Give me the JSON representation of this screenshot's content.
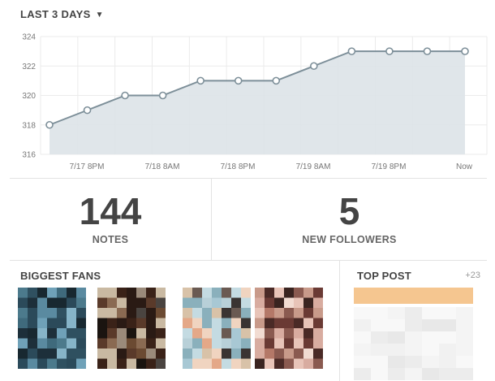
{
  "header": {
    "period_label": "LAST 3 DAYS"
  },
  "chart_data": {
    "type": "area",
    "x": [
      "7/17 8PM",
      "7/18 8AM",
      "7/18 8PM",
      "7/19 8AM",
      "7/19 8PM",
      "Now"
    ],
    "series": [
      {
        "values": [
          318,
          319,
          320,
          320,
          321,
          321,
          321,
          322,
          323,
          323,
          323,
          323
        ]
      }
    ],
    "ylim": [
      316,
      324
    ],
    "yticks": [
      316,
      318,
      320,
      322,
      324
    ],
    "xlabel": "",
    "ylabel": "",
    "title": "",
    "grid": true,
    "colors": {
      "line": "#7d8f99",
      "fill": "#dde3e8",
      "marker_fill": "#ffffff",
      "grid": "#ebebeb"
    }
  },
  "stats": {
    "notes": {
      "value": "144",
      "label": "NOTES"
    },
    "followers": {
      "value": "5",
      "label": "NEW FOLLOWERS"
    }
  },
  "fans": {
    "title": "BIGGEST FANS",
    "avatars": [
      {
        "palette": [
          "#2b4a5a",
          "#3f6a7c",
          "#5a8aa0",
          "#1d2f3a",
          "#6fa1b8",
          "#2f5060",
          "#4c7a8c",
          "#182830",
          "#86b4c8"
        ]
      },
      {
        "palette": [
          "#3a2218",
          "#6b4a32",
          "#8a6a52",
          "#2a1a14",
          "#4a4440",
          "#c9b9a2",
          "#5a3a2a",
          "#1a1410",
          "#9a8a7a"
        ]
      },
      {
        "palette": [
          "#a8c8d4",
          "#c4dbe2",
          "#8ab0bc",
          "#3a3432",
          "#d8c2a8",
          "#e4a888",
          "#6a5a52",
          "#b8d0d8",
          "#f0d4c0"
        ]
      },
      {
        "palette": [
          "#3a2420",
          "#6a3a34",
          "#c89a8a",
          "#e8c4b8",
          "#8a5a50",
          "#f2dcd2",
          "#b47868",
          "#4a2a26",
          "#d8aca0"
        ]
      }
    ]
  },
  "top_post": {
    "title": "TOP POST",
    "count": "+23",
    "accent": "#f5c690"
  }
}
